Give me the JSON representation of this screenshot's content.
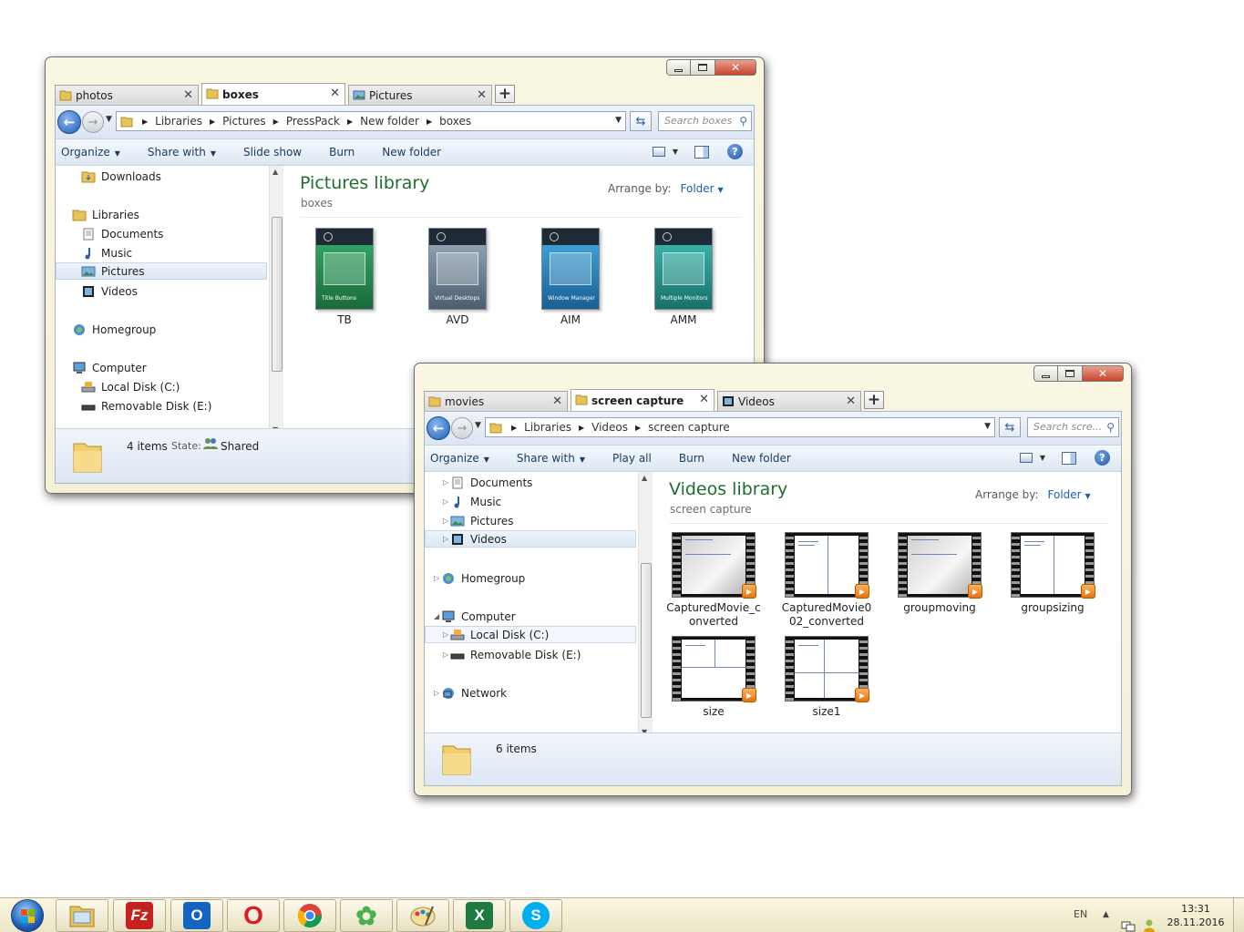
{
  "window1": {
    "tabs": [
      {
        "label": "photos",
        "icon": "folder-icon"
      },
      {
        "label": "boxes",
        "icon": "folder-icon",
        "active": true
      },
      {
        "label": "Pictures",
        "icon": "pictures-library-icon"
      }
    ],
    "breadcrumb": [
      "Libraries",
      "Pictures",
      "PressPack",
      "New folder",
      "boxes"
    ],
    "search_placeholder": "Search boxes",
    "commands": [
      "Organize",
      "Share with",
      "Slide show",
      "Burn",
      "New folder"
    ],
    "nav": {
      "downloads": "Downloads",
      "libraries": "Libraries",
      "documents": "Documents",
      "music": "Music",
      "pictures": "Pictures",
      "videos": "Videos",
      "homegroup": "Homegroup",
      "computer": "Computer",
      "local_disk": "Local Disk (C:)",
      "removable_disk": "Removable Disk (E:)"
    },
    "library_title": "Pictures library",
    "library_subtitle": "boxes",
    "arrange_label": "Arrange by:",
    "arrange_value": "Folder",
    "files": [
      {
        "name": "TB",
        "color": "#2f9a5a",
        "box_text": "Title Buttons"
      },
      {
        "name": "AVD",
        "color": "#7d8fa3",
        "box_text": "Virtual Desktops"
      },
      {
        "name": "AIM",
        "color": "#2d8ec7",
        "box_text": "Window Manager"
      },
      {
        "name": "AMM",
        "color": "#2aa39a",
        "box_text": "Multiple Monitors"
      }
    ],
    "status": {
      "items": "4 items",
      "state_label": "State:",
      "state_value": "Shared"
    }
  },
  "window2": {
    "tabs": [
      {
        "label": "movies",
        "icon": "folder-icon"
      },
      {
        "label": "screen capture",
        "icon": "folder-icon",
        "active": true
      },
      {
        "label": "Videos",
        "icon": "videos-library-icon"
      }
    ],
    "breadcrumb": [
      "Libraries",
      "Videos",
      "screen capture"
    ],
    "search_placeholder": "Search scre...",
    "commands": [
      "Organize",
      "Share with",
      "Play all",
      "Burn",
      "New folder"
    ],
    "nav": {
      "documents": "Documents",
      "music": "Music",
      "pictures": "Pictures",
      "videos": "Videos",
      "homegroup": "Homegroup",
      "computer": "Computer",
      "local_disk": "Local Disk (C:)",
      "removable_disk": "Removable Disk (E:)",
      "network": "Network"
    },
    "library_title": "Videos library",
    "library_subtitle": "screen capture",
    "arrange_label": "Arrange by:",
    "arrange_value": "Folder",
    "files": [
      {
        "line1": "CapturedMovie_c",
        "line2": "onverted",
        "style": "gray"
      },
      {
        "line1": "CapturedMovie0",
        "line2": "02_converted",
        "style": "white"
      },
      {
        "line1": "groupmoving",
        "line2": "",
        "style": "gray"
      },
      {
        "line1": "groupsizing",
        "line2": "",
        "style": "white"
      },
      {
        "line1": "size",
        "line2": "",
        "style": "white"
      },
      {
        "line1": "size1",
        "line2": "",
        "style": "white"
      }
    ],
    "status": {
      "items": "6 items"
    }
  },
  "taskbar": {
    "apps": [
      {
        "name": "windows-explorer",
        "glyph": "",
        "color": "#e8c96a"
      },
      {
        "name": "filezilla",
        "glyph": "Fz",
        "color": "#c5221f"
      },
      {
        "name": "outlook",
        "glyph": "O",
        "color": "#1565c0"
      },
      {
        "name": "opera",
        "glyph": "O",
        "color": "#e01a24"
      },
      {
        "name": "chrome",
        "glyph": "",
        "color": "#4285f4"
      },
      {
        "name": "icq",
        "glyph": "✿",
        "color": "#4caf50"
      },
      {
        "name": "paint",
        "glyph": "",
        "color": "#f3c46b"
      },
      {
        "name": "excel",
        "glyph": "X",
        "color": "#1f7a3f"
      },
      {
        "name": "skype",
        "glyph": "S",
        "color": "#00aff0"
      }
    ],
    "language": "EN",
    "time": "13:31",
    "date": "28.11.2016"
  }
}
